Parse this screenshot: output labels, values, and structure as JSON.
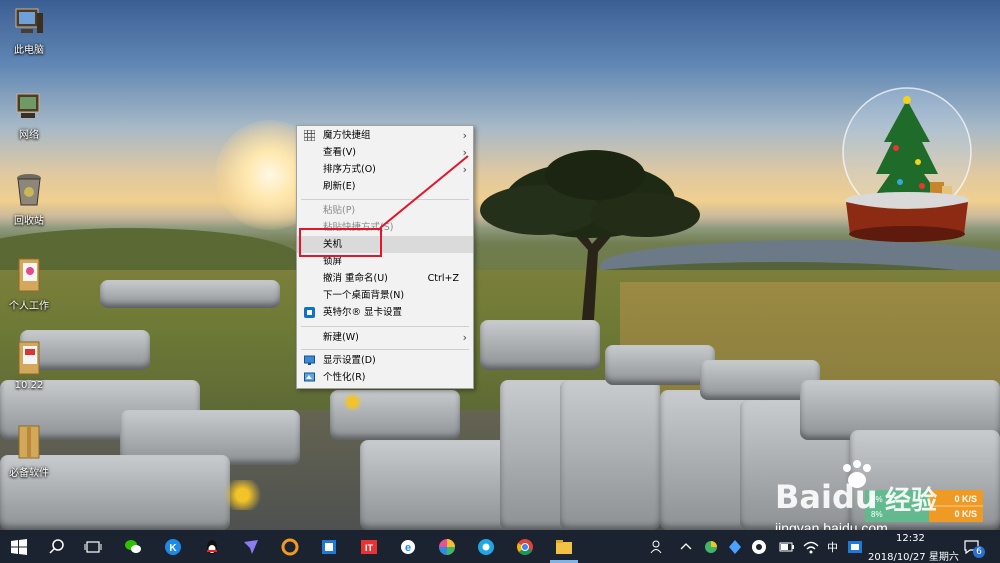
{
  "desktop_icons": [
    {
      "label": "此电脑",
      "icon": "computer-icon"
    },
    {
      "label": "网络",
      "icon": "network-icon"
    },
    {
      "label": "回收站",
      "icon": "recycle-bin-icon"
    },
    {
      "label": "个人工作",
      "icon": "folder-icon"
    },
    {
      "label": "10.22",
      "icon": "folder-icon"
    },
    {
      "label": "必备软件",
      "icon": "folder-icon"
    }
  ],
  "context_menu": {
    "items": [
      {
        "label": "魔方快捷组",
        "has_submenu": true,
        "icon": "grid-icon"
      },
      {
        "label": "查看(V)",
        "has_submenu": true
      },
      {
        "label": "排序方式(O)",
        "has_submenu": true
      },
      {
        "label": "刷新(E)"
      },
      {
        "label": "粘贴(P)",
        "disabled": true
      },
      {
        "label": "粘贴快捷方式(S)",
        "disabled": true
      },
      {
        "label": "关机",
        "highlighted": true
      },
      {
        "label": "锁屏"
      },
      {
        "label": "撤消 重命名(U)",
        "shortcut": "Ctrl+Z"
      },
      {
        "label": "下一个桌面背景(N)"
      },
      {
        "label": "英特尔® 显卡设置",
        "icon": "intel-graphics-icon"
      },
      {
        "label": "新建(W)",
        "has_submenu": true
      },
      {
        "label": "显示设置(D)",
        "icon": "display-icon"
      },
      {
        "label": "个性化(R)",
        "icon": "personalize-icon"
      }
    ]
  },
  "network_monitor": {
    "up_percent": "8%",
    "down_percent": "8%",
    "up_speed": "0 K/S",
    "down_speed": "0 K/S"
  },
  "watermark": {
    "brand": "Baidu",
    "cn": "经验",
    "url": "jingyan.baidu.com"
  },
  "taskbar": {
    "ime": "中",
    "time": "12:32",
    "date": "2018/10/27 星期六",
    "notification_count": "6",
    "pinned": [
      "wechat-icon",
      "kugou-icon",
      "qq-icon",
      "feishu-icon",
      "browser-ring-icon",
      "office-icon",
      "toutiao-icon",
      "ie-icon",
      "color-wheel-icon",
      "qq-music-icon",
      "chrome-icon",
      "file-explorer-icon"
    ]
  },
  "colors": {
    "taskbar": "#1b2331",
    "highlight_box": "#e2162b",
    "menu_bg": "#f2f2f2"
  }
}
